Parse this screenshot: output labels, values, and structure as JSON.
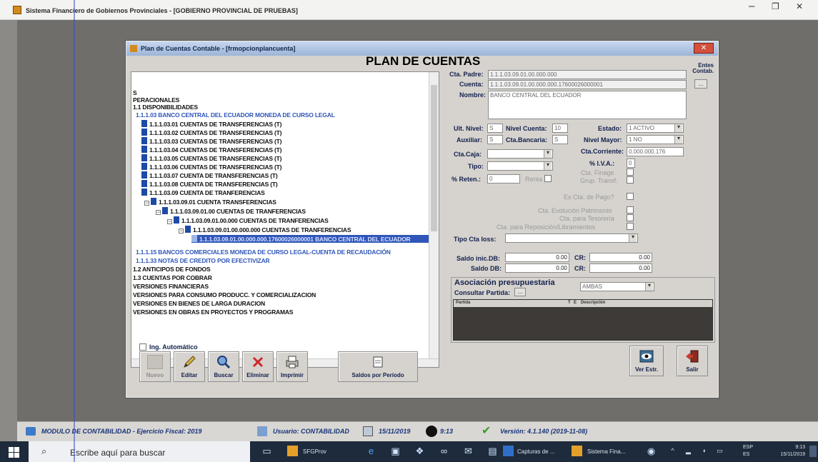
{
  "app": {
    "title": "Sistema Financiero de Gobiernos Provinciales - [GOBIERNO PROVINCIAL DE PRUEBAS]",
    "min_icon": "–",
    "restore_icon": "❐",
    "close_icon": "✕"
  },
  "dialog": {
    "title": "Plan de Cuentas Contable - [frmopcionplancuenta]",
    "heading": "PLAN DE CUENTAS"
  },
  "tree": {
    "items": [
      {
        "text": "S"
      },
      {
        "text": "PERACIONALES"
      },
      {
        "text": "1.1 DISPONIBILIDADES"
      },
      {
        "text": "1.1.1.03 BANCO CENTRAL DEL ECUADOR MONEDA DE CURSO LEGAL"
      },
      {
        "text": "1.1.1.03.01 CUENTAS DE TRANSFERENCIAS  (T)"
      },
      {
        "text": "1.1.1.03.02 CUENTAS DE TRANSFERENCIAS  (T)"
      },
      {
        "text": "1.1.1.03.03 CUENTAS DE TRANSFERENCIAS (T)"
      },
      {
        "text": "1.1.1.03.04 CUENTAS DE TRANSFERENCIAS (T)"
      },
      {
        "text": "1.1.1.03.05 CUENTAS DE TRANSFERENCIAS (T)"
      },
      {
        "text": "1.1.1.03.06 CUENTAS DE TRANSFERENCIAS  (T)"
      },
      {
        "text": "1.1.1.03.07 CUENTA DE TRANSFERENCIAS (T)"
      },
      {
        "text": "1.1.1.03.08 CUENTA DE TRANSFERENCIAS (T)"
      },
      {
        "text": "1.1.1.03.09 CUENTA DE TRANFERENCIAS"
      },
      {
        "text": "1.1.1.03.09.01 CUENTA TRANSFERENCIAS"
      },
      {
        "text": "1.1.1.03.09.01.00 CUENTAS DE TRANFERENCIAS"
      },
      {
        "text": "1.1.1.03.09.01.00.000 CUENTAS DE TRANFERENCIAS"
      },
      {
        "text": "1.1.1.03.09.01.00.000.000 CUENTAS DE TRANFERENCIAS"
      },
      {
        "text": "1.1.1.03.09.01.00.000.000.17600026000001 BANCO CENTRAL DEL ECUADOR"
      },
      {
        "text": "1.1.1.15 BANCOS COMERCIALES MONEDA DE CURSO LEGAL-CUENTA DE RECAUDACIÓN"
      },
      {
        "text": "1.1.1.33 NOTAS DE CREDITO POR EFECTIVIZAR"
      },
      {
        "text": "1.2 ANTICIPOS DE FONDOS"
      },
      {
        "text": "1.3 CUENTAS POR COBRAR"
      },
      {
        "text": "VERSIONES FINANCIERAS"
      },
      {
        "text": "VERSIONES PARA CONSUMO PRODUCC. Y COMERCIALIZACION"
      },
      {
        "text": "VERSIONES EN BIENES DE LARGA DURACION"
      },
      {
        "text": "VERSIONES EN OBRAS EN PROYECTOS Y PROGRAMAS"
      }
    ]
  },
  "form": {
    "cta_padre_label": "Cta. Padre:",
    "cta_padre_value": "1.1.1.03.09.01.00.000.000",
    "entes_label": "Entes Contab.",
    "cuenta_label": "Cuenta:",
    "cuenta_value": "1.1.1.03.09.01.00.000.000.17600026000001",
    "nombre_label": "Nombre:",
    "nombre_value": "BANCO CENTRAL DEL ECUADOR",
    "ult_nivel_label": "Ult. Nivel:",
    "ult_nivel_value": "S",
    "nivel_cuenta_label": "Nivel Cuenta:",
    "nivel_cuenta_value": "10",
    "estado_label": "Estado:",
    "estado_value": "1 ACTIVO",
    "auxiliar_label": "Auxiliar:",
    "auxiliar_value": "S",
    "cta_bancaria_label": "Cta.Bancaria:",
    "cta_bancaria_value": "S",
    "nivel_mayor_label": "Nivel Mayor:",
    "nivel_mayor_value": "1 NO",
    "cta_caja_label": "Cta.Caja:",
    "cta_corriente_label": "Cta.Corriente:",
    "cta_corriente_value": "0.000.000.176",
    "tipo_label": "Tipo:",
    "iva_label": "% I.V.A.:",
    "iva_value": "0",
    "cta_finage_label": "Cta. Finage",
    "reten_label": "% Reten.:",
    "reten_value": "0",
    "renta_label": "Renta",
    "grup_transf_label": "Grup. Transf.",
    "es_cta_pago_label": "Es Cta. de Pago?",
    "evolucion_label": "Cta. Evolución Patrimonio",
    "tesoreria_label": "Cta. para Tesorería",
    "reposicion_label": "Cta. para Reposición/Libramientos",
    "tipo_cta_label": "Tipo Cta Ioss:",
    "saldo_inic_label": "Saldo inic.DB:",
    "saldo_inic_db": "0.00",
    "cr_label": "CR:",
    "saldo_inic_cr": "0.00",
    "saldo_db_label": "Saldo DB:",
    "saldo_db": "0.00",
    "saldo_cr": "0.00"
  },
  "asociacion": {
    "title": "Asociación presupuestaria",
    "consultar_label": "Consultar Partida:",
    "filter_value": "AMBAS",
    "col_partida": "Partida",
    "col_t": "T",
    "col_e": "E",
    "col_desc": "Descripción"
  },
  "buttons": {
    "ing_auto_label": "Ing. Automático",
    "nuevo": "Nuevo",
    "editar": "Editar",
    "buscar": "Buscar",
    "eliminar": "Eliminar",
    "imprimir": "Imprimir",
    "saldos": "Saldos por Período",
    "ver_estr": "Ver Estr.",
    "salir": "Salir"
  },
  "status": {
    "modulo": "MODULO DE CONTABILIDAD - Ejercicio Fiscal: 2019",
    "usuario": "Usuario: CONTABILIDAD",
    "fecha": "15/11/2019",
    "hora": "9:13",
    "version": "Versión: 4.1.140 (2019-11-08)"
  },
  "taskbar": {
    "search_placeholder": "Escribe aquí para buscar",
    "app1": "SFGProv",
    "app2": "Capturas de ...",
    "app3": "Sistema Fina...",
    "tray_lang": "ESP",
    "tray_lang2": "ES",
    "tray_time": "9:13",
    "tray_date": "15/11/2019"
  },
  "colors": {
    "accent_blue": "#2f56b8",
    "label_navy": "#12204d"
  }
}
